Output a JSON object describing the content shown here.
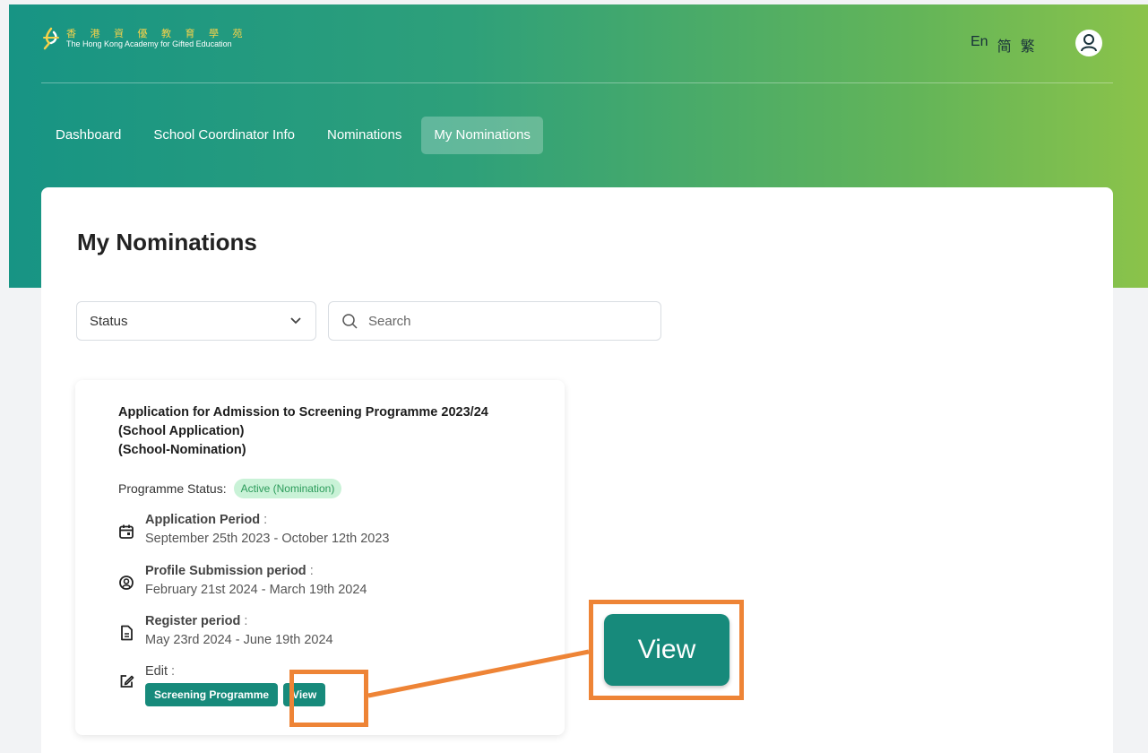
{
  "header": {
    "logo": {
      "name_zh": "香 港 資 優 教 育 學 苑",
      "name_en": "The Hong Kong Academy for Gifted Education"
    },
    "languages": [
      "En",
      "简",
      "繁"
    ]
  },
  "nav": {
    "items": [
      "Dashboard",
      "School Coordinator Info",
      "Nominations",
      "My Nominations"
    ],
    "active": "My Nominations"
  },
  "main": {
    "title": "My Nominations",
    "filters": {
      "status_label": "Status",
      "search_placeholder": "Search"
    },
    "card": {
      "title_lines": [
        "Application for Admission to Screening Programme 2023/24",
        "(School Application)",
        "(School-Nomination)"
      ],
      "programme_status_label": "Programme Status:",
      "programme_status_value": "Active (Nomination)",
      "periods": [
        {
          "label": "Application Period",
          "range": "September 25th 2023 - October 12th 2023",
          "icon": "calendar-icon"
        },
        {
          "label": "Profile Submission period",
          "range": "February 21st 2024 - March 19th 2024",
          "icon": "user-circle-icon"
        },
        {
          "label": "Register period",
          "range": "May 23rd 2024 - June 19th 2024",
          "icon": "document-icon"
        }
      ],
      "edit_label": "Edit",
      "colon": ":",
      "buttons": [
        "Screening Programme",
        "View"
      ]
    }
  },
  "callout": {
    "zoom_label": "View",
    "highlight_color": "#ee8436"
  },
  "colors": {
    "gradient_start": "#179484",
    "gradient_end": "#8bc34a",
    "button": "#178a7b",
    "badge_bg": "#c9f2d7",
    "badge_text": "#2b9b5a"
  }
}
